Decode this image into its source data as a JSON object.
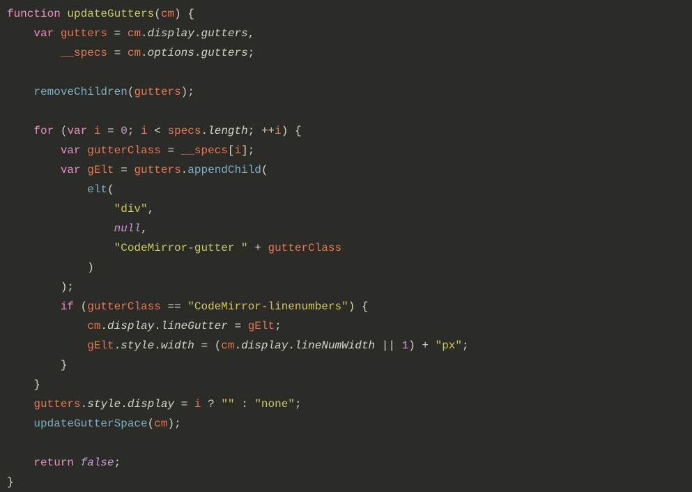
{
  "code": {
    "line1": {
      "kw_function": "function",
      "fn_name": "updateGutters",
      "paren_open": "(",
      "param": "cm",
      "paren_close": ")",
      "brace": " {"
    },
    "line2": {
      "indent": "    ",
      "kw_var": "var",
      "var1": " gutters",
      "eq": " = ",
      "obj": "cm",
      "dot1": ".",
      "prop1": "display",
      "dot2": ".",
      "prop2": "gutters",
      "comma": ","
    },
    "line3": {
      "indent": "        ",
      "var1": "__specs",
      "eq": " = ",
      "obj": "cm",
      "dot1": ".",
      "prop1": "options",
      "dot2": ".",
      "prop2": "gutters",
      "semi": ";"
    },
    "line4": {
      "blank": ""
    },
    "line5": {
      "indent": "    ",
      "fn": "removeChildren",
      "paren_open": "(",
      "arg": "gutters",
      "paren_close": ")",
      "semi": ";"
    },
    "line6": {
      "blank": ""
    },
    "line7": {
      "indent": "    ",
      "kw_for": "for",
      "space": " ",
      "paren_open": "(",
      "kw_var": "var",
      "var_i": " i",
      "eq": " = ",
      "zero": "0",
      "semi1": "; ",
      "i": "i",
      "lt": " < ",
      "specs": "specs",
      "dot": ".",
      "length": "length",
      "semi2": "; ",
      "inc": "++",
      "i2": "i",
      "paren_close": ")",
      "brace": " {"
    },
    "line8": {
      "indent": "        ",
      "kw_var": "var",
      "var1": " gutterClass",
      "eq": " = ",
      "specs": "__specs",
      "bracket_open": "[",
      "i": "i",
      "bracket_close": "]",
      "semi": ";"
    },
    "line9": {
      "indent": "        ",
      "kw_var": "var",
      "var1": " gElt",
      "eq": " = ",
      "gutters": "gutters",
      "dot": ".",
      "fn": "appendChild",
      "paren_open": "("
    },
    "line10": {
      "indent": "            ",
      "fn": "elt",
      "paren_open": "("
    },
    "line11": {
      "indent": "                ",
      "str": "\"div\"",
      "comma": ","
    },
    "line12": {
      "indent": "                ",
      "null": "null",
      "comma": ","
    },
    "line13": {
      "indent": "                ",
      "str": "\"CodeMirror-gutter \"",
      "plus": " + ",
      "var1": "gutterClass"
    },
    "line14": {
      "indent": "            ",
      "paren_close": ")"
    },
    "line15": {
      "indent": "        ",
      "paren_close": ")",
      "semi": ";"
    },
    "line16": {
      "indent": "        ",
      "kw_if": "if",
      "space": " ",
      "paren_open": "(",
      "var1": "gutterClass",
      "eq": " == ",
      "str": "\"CodeMirror-linenumbers\"",
      "paren_close": ")",
      "brace": " {"
    },
    "line17": {
      "indent": "            ",
      "obj": "cm",
      "dot1": ".",
      "prop1": "display",
      "dot2": ".",
      "prop2": "lineGutter",
      "eq": " = ",
      "var1": "gElt",
      "semi": ";"
    },
    "line18": {
      "indent": "            ",
      "var1": "gElt",
      "dot1": ".",
      "prop1": "style",
      "dot2": ".",
      "prop2": "width",
      "eq": " = ",
      "paren_open": "(",
      "obj2": "cm",
      "dot3": ".",
      "prop3": "display",
      "dot4": ".",
      "prop4": "lineNumWidth",
      "or": " || ",
      "one": "1",
      "paren_close": ")",
      "plus": " + ",
      "str": "\"px\"",
      "semi": ";"
    },
    "line19": {
      "indent": "        ",
      "brace": "}"
    },
    "line20": {
      "indent": "    ",
      "brace": "}"
    },
    "line21": {
      "indent": "    ",
      "var1": "gutters",
      "dot1": ".",
      "prop1": "style",
      "dot2": ".",
      "prop2": "display",
      "eq": " = ",
      "i": "i",
      "ternary": " ? ",
      "str1": "\"\"",
      "colon": " : ",
      "str2": "\"none\"",
      "semi": ";"
    },
    "line22": {
      "indent": "    ",
      "fn": "updateGutterSpace",
      "paren_open": "(",
      "arg": "cm",
      "paren_close": ")",
      "semi": ";"
    },
    "line23": {
      "blank": ""
    },
    "line24": {
      "indent": "    ",
      "kw_return": "return",
      "space": " ",
      "false": "false",
      "semi": ";"
    },
    "line25": {
      "brace": "}"
    }
  }
}
